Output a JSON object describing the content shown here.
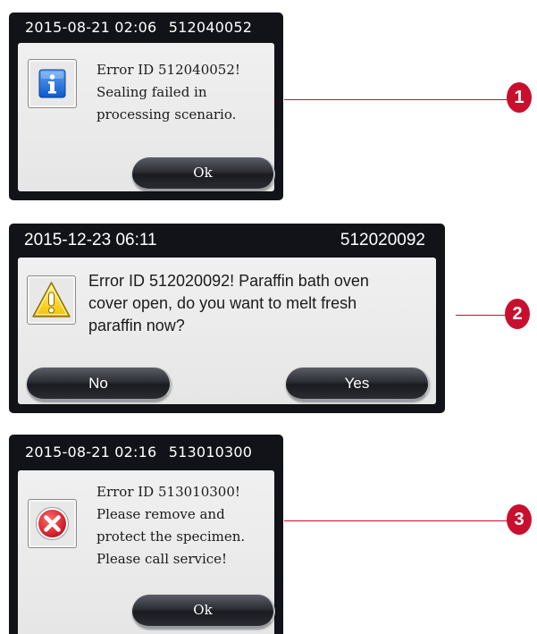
{
  "colors": {
    "header_bg": "#121318",
    "body_bg": "#ececec",
    "button_bg": "#2d2f36",
    "callout_red": "#c8102e",
    "info_blue": "#1e6fd9",
    "warning_yellow": "#f7d21a",
    "error_red": "#d7192d"
  },
  "dialogs": [
    {
      "header": {
        "date": "2015-08-21 02:06",
        "id": "512040052"
      },
      "icon": "info-icon",
      "message_lines": [
        "Error ID 512040052!",
        "Sealing failed in",
        "processing scenario."
      ],
      "buttons": [
        {
          "label": "Ok"
        }
      ],
      "callout": "1"
    },
    {
      "header": {
        "date": "2015-12-23 06:11",
        "id": "512020092"
      },
      "icon": "warning-icon",
      "message_lines": [
        "Error ID 512020092! Paraffin bath oven",
        "cover open, do you want to melt fresh",
        "paraffin now?"
      ],
      "buttons": [
        {
          "label": "No"
        },
        {
          "label": "Yes"
        }
      ],
      "callout": "2"
    },
    {
      "header": {
        "date": "2015-08-21 02:16",
        "id": "513010300"
      },
      "icon": "error-icon",
      "message_lines": [
        "Error ID 513010300!",
        "Please remove and",
        "protect the specimen.",
        "Please call service!"
      ],
      "buttons": [
        {
          "label": "Ok"
        }
      ],
      "callout": "3"
    }
  ]
}
